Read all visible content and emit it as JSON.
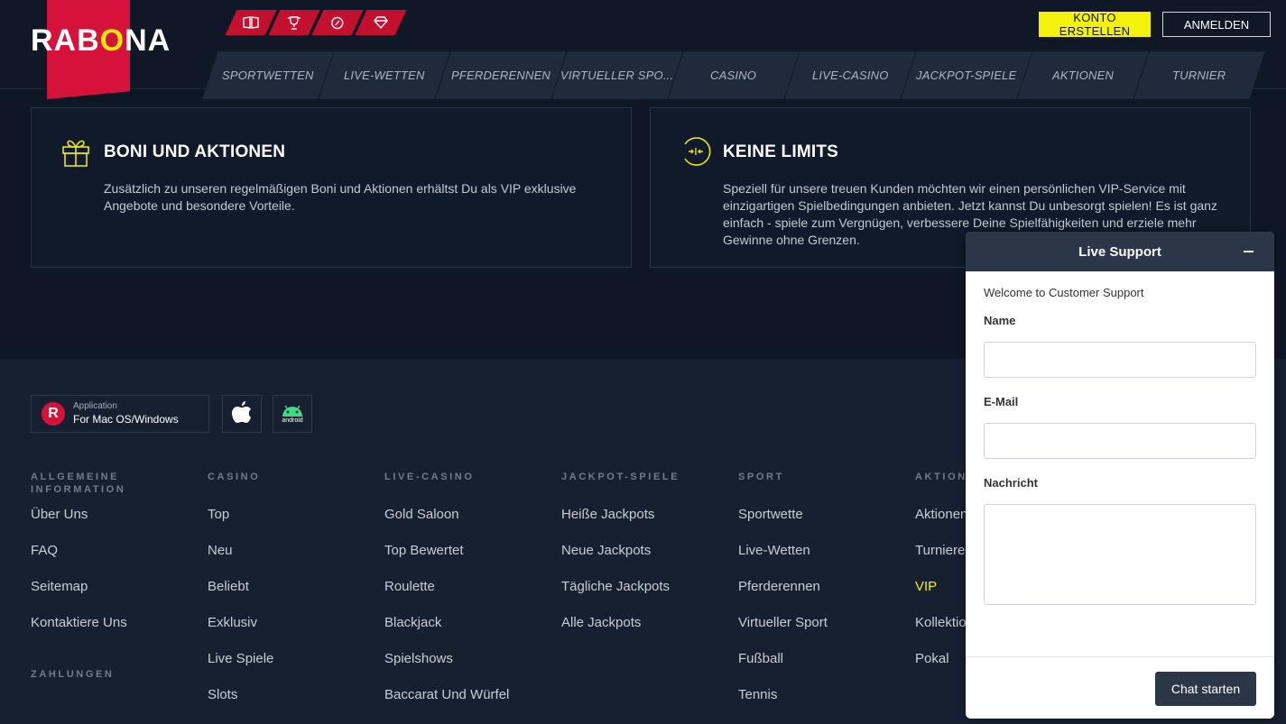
{
  "brand": {
    "name_pre": "RAB",
    "name_o": "O",
    "name_post": "NA"
  },
  "header": {
    "icon_tabs": [
      "book-icon",
      "trophy-icon",
      "rocket-icon",
      "diamond-icon"
    ],
    "register_label": "KONTO ERSTELLEN",
    "login_label": "ANMELDEN",
    "nav": [
      "SPORTWETTEN",
      "LIVE-WETTEN",
      "PFERDERENNEN",
      "VIRTUELLER SPO...",
      "CASINO",
      "LIVE-CASINO",
      "JACKPOT-SPIELE",
      "AKTIONEN",
      "TURNIER"
    ]
  },
  "cards": [
    {
      "icon": "gift-icon",
      "title": "BONI UND AKTIONEN",
      "body": "Zusätzlich zu unseren regelmäßigen Boni und Aktionen erhältst Du als VIP exklusive Angebote und besondere Vorteile."
    },
    {
      "icon": "no-limits-icon",
      "title": "KEINE LIMITS",
      "body": "Speziell für unsere treuen Kunden möchten wir einen persönlichen VIP-Service mit einzigartigen Spielbedingungen anbieten. Jetzt kannst Du unbesorgt spielen! Es ist ganz einfach - spiele zum Vergnügen, verbessere Deine Spielfähigkeiten und erziele mehr Gewinne ohne Grenzen."
    }
  ],
  "footer": {
    "app": {
      "small": "Application",
      "big": "For Mac OS/Windows",
      "letter": "R"
    },
    "android_label": "android",
    "columns": [
      {
        "head": "ALLGEMEINE INFORMATION",
        "links": [
          "Über Uns",
          "FAQ",
          "Seitemap",
          "Kontaktiere Uns"
        ]
      },
      {
        "head": "CASINO",
        "links": [
          "Top",
          "Neu",
          "Beliebt",
          "Exklusiv",
          "Live Spiele",
          "Slots"
        ]
      },
      {
        "head": "LIVE-CASINO",
        "links": [
          "Gold Saloon",
          "Top Bewertet",
          "Roulette",
          "Blackjack",
          "Spielshows",
          "Baccarat Und Würfel"
        ]
      },
      {
        "head": "JACKPOT-SPIELE",
        "links": [
          "Heiße Jackpots",
          "Neue Jackpots",
          "Tägliche Jackpots",
          "Alle Jackpots"
        ]
      },
      {
        "head": "SPORT",
        "links": [
          "Sportwette",
          "Live-Wetten",
          "Pferderennen",
          "Virtueller Sport",
          "Fußball",
          "Tennis"
        ]
      },
      {
        "head": "AKTIONE",
        "links": [
          "Aktionen",
          "Turniere",
          "VIP",
          "Kollektio",
          "Pokal"
        ]
      }
    ],
    "payments_head": "ZAHLUNGEN",
    "highlight_color": "#f2f20a"
  },
  "support": {
    "title": "Live Support",
    "welcome": "Welcome to Customer Support",
    "name_label": "Name",
    "email_label": "E-Mail",
    "message_label": "Nachricht",
    "name_value": "",
    "email_value": "",
    "message_value": "",
    "start_label": "Chat starten"
  }
}
